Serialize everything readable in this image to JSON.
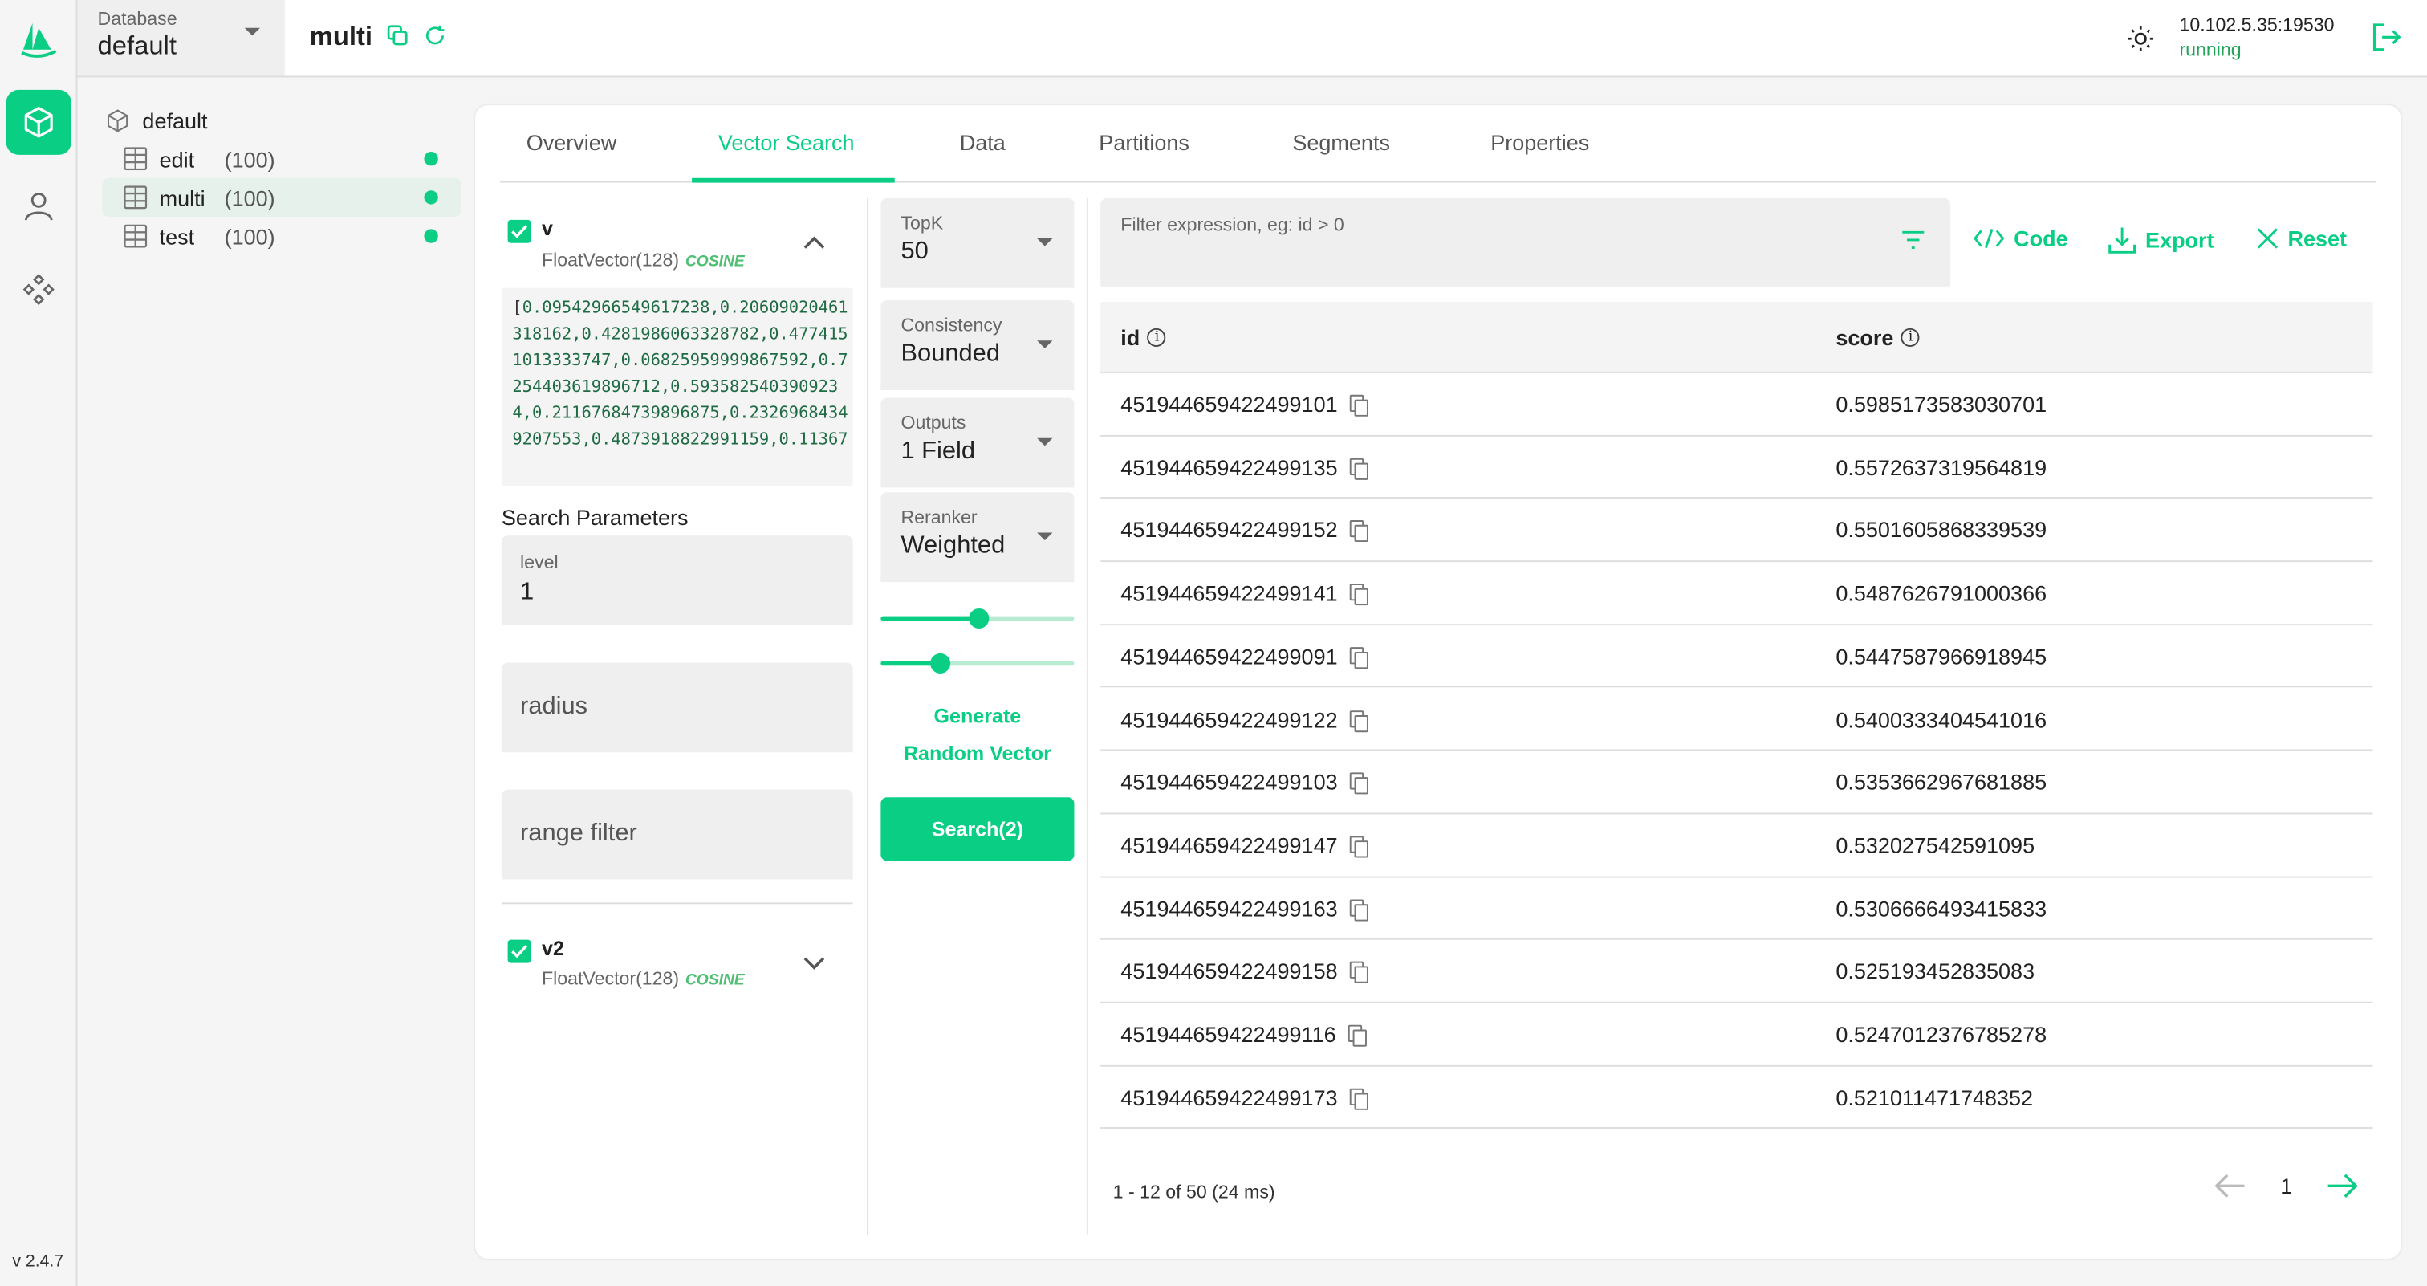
{
  "app": {
    "version": "v 2.4.7",
    "colors": {
      "accent": "#0bce85",
      "running": "#21a45a"
    }
  },
  "rail": {
    "items": [
      {
        "icon": "cube-icon",
        "label": "Databases",
        "active": true
      },
      {
        "icon": "user-icon",
        "label": "Users",
        "active": false
      },
      {
        "icon": "diamonds-icon",
        "label": "System",
        "active": false
      }
    ]
  },
  "database_selector": {
    "label": "Database",
    "value": "default"
  },
  "header": {
    "collection": "multi",
    "address": "10.102.5.35:19530",
    "status": "running"
  },
  "tree": {
    "database": "default",
    "collections": [
      {
        "name": "edit",
        "count": "(100)",
        "loaded": true,
        "selected": false
      },
      {
        "name": "multi",
        "count": "(100)",
        "loaded": true,
        "selected": true
      },
      {
        "name": "test",
        "count": "(100)",
        "loaded": true,
        "selected": false
      }
    ]
  },
  "tabs": [
    {
      "label": "Overview",
      "active": false
    },
    {
      "label": "Vector Search",
      "active": true
    },
    {
      "label": "Data",
      "active": false
    },
    {
      "label": "Partitions",
      "active": false
    },
    {
      "label": "Segments",
      "active": false
    },
    {
      "label": "Properties",
      "active": false
    }
  ],
  "vector_fields": [
    {
      "name": "v",
      "type": "FloatVector(128)",
      "metric": "COSINE",
      "checked": true,
      "expanded": true,
      "value_open": "[",
      "value": "0.09542966549617238,0.20609020461318162,0.4281986063328782,0.4774151013333747,0.06825959999867592,0.7254403619896712,0.5935825403909234,0.21167684739896875,0.23269684349207553,0.4873918822991159,0.11367"
    },
    {
      "name": "v2",
      "type": "FloatVector(128)",
      "metric": "COSINE",
      "checked": true,
      "expanded": false
    }
  ],
  "search_params": {
    "title": "Search Parameters",
    "level": {
      "label": "level",
      "value": "1"
    },
    "radius": {
      "placeholder": "radius"
    },
    "range_filter": {
      "placeholder": "range filter"
    }
  },
  "options": {
    "topk": {
      "label": "TopK",
      "value": "50"
    },
    "consistency": {
      "label": "Consistency",
      "value": "Bounded"
    },
    "outputs": {
      "label": "Outputs",
      "value": "1 Field"
    },
    "reranker": {
      "label": "Reranker",
      "value": "Weighted"
    },
    "weights": [
      0.5,
      0.3
    ],
    "generate_label_1": "Generate",
    "generate_label_2": "Random Vector",
    "search_label": "Search(2)"
  },
  "toolbar": {
    "filter_placeholder": "Filter expression, eg: id > 0",
    "code_label": "Code",
    "export_label": "Export",
    "reset_label": "Reset"
  },
  "results": {
    "columns": [
      "id",
      "score"
    ],
    "rows": [
      {
        "id": "451944659422499101",
        "score": "0.5985173583030701"
      },
      {
        "id": "451944659422499135",
        "score": "0.5572637319564819"
      },
      {
        "id": "451944659422499152",
        "score": "0.5501605868339539"
      },
      {
        "id": "451944659422499141",
        "score": "0.5487626791000366"
      },
      {
        "id": "451944659422499091",
        "score": "0.5447587966918945"
      },
      {
        "id": "451944659422499122",
        "score": "0.5400333404541016"
      },
      {
        "id": "451944659422499103",
        "score": "0.5353662967681885"
      },
      {
        "id": "451944659422499147",
        "score": "0.532027542591095"
      },
      {
        "id": "451944659422499163",
        "score": "0.5306666493415833"
      },
      {
        "id": "451944659422499158",
        "score": "0.525193452835083"
      },
      {
        "id": "451944659422499116",
        "score": "0.5247012376785278"
      },
      {
        "id": "451944659422499173",
        "score": "0.521011471748352"
      }
    ],
    "summary": "1 - 12  of 50 (24 ms)",
    "page": "1"
  }
}
